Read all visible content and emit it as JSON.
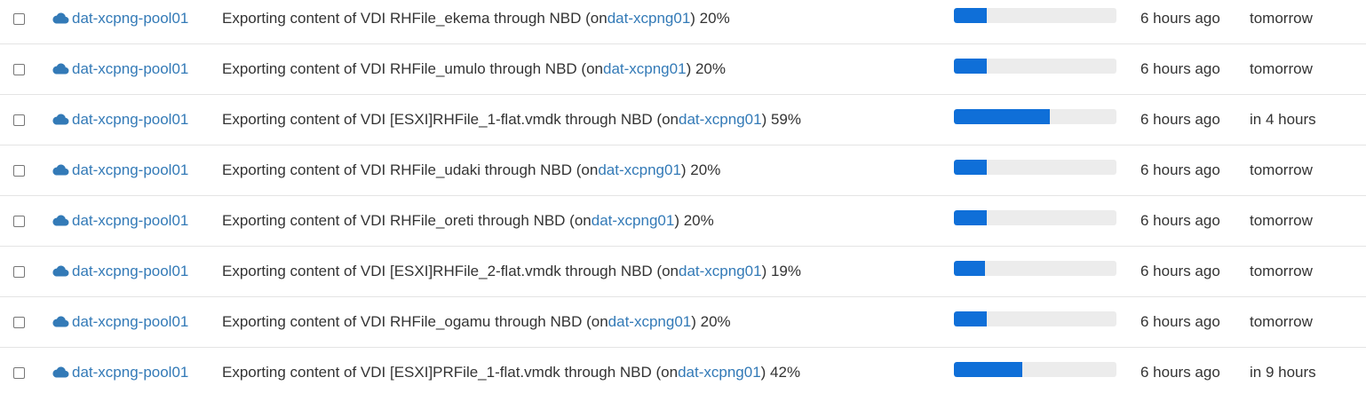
{
  "colors": {
    "link": "#337ab7",
    "progress_fill": "#0f6fd8",
    "progress_track": "#ececec",
    "row_border": "#e4e4e4"
  },
  "icons": {
    "pool": "cloud-icon"
  },
  "tasks": [
    {
      "pool": "dat-xcpng-pool01",
      "desc_prefix": "Exporting content of VDI RHFile_ekema through NBD (on ",
      "host": "dat-xcpng01",
      "desc_suffix": ") 20%",
      "progress": 20,
      "started": "6 hours ago",
      "eta": "tomorrow"
    },
    {
      "pool": "dat-xcpng-pool01",
      "desc_prefix": "Exporting content of VDI RHFile_umulo through NBD (on ",
      "host": "dat-xcpng01",
      "desc_suffix": ") 20%",
      "progress": 20,
      "started": "6 hours ago",
      "eta": "tomorrow"
    },
    {
      "pool": "dat-xcpng-pool01",
      "desc_prefix": "Exporting content of VDI [ESXI]RHFile_1-flat.vmdk through NBD (on ",
      "host": "dat-xcpng01",
      "desc_suffix": ") 59%",
      "progress": 59,
      "started": "6 hours ago",
      "eta": "in 4 hours"
    },
    {
      "pool": "dat-xcpng-pool01",
      "desc_prefix": "Exporting content of VDI RHFile_udaki through NBD (on ",
      "host": "dat-xcpng01",
      "desc_suffix": ") 20%",
      "progress": 20,
      "started": "6 hours ago",
      "eta": "tomorrow"
    },
    {
      "pool": "dat-xcpng-pool01",
      "desc_prefix": "Exporting content of VDI RHFile_oreti through NBD (on ",
      "host": "dat-xcpng01",
      "desc_suffix": ") 20%",
      "progress": 20,
      "started": "6 hours ago",
      "eta": "tomorrow"
    },
    {
      "pool": "dat-xcpng-pool01",
      "desc_prefix": "Exporting content of VDI [ESXI]RHFile_2-flat.vmdk through NBD (on ",
      "host": "dat-xcpng01",
      "desc_suffix": ") 19%",
      "progress": 19,
      "started": "6 hours ago",
      "eta": "tomorrow"
    },
    {
      "pool": "dat-xcpng-pool01",
      "desc_prefix": "Exporting content of VDI RHFile_ogamu through NBD (on ",
      "host": "dat-xcpng01",
      "desc_suffix": ") 20%",
      "progress": 20,
      "started": "6 hours ago",
      "eta": "tomorrow"
    },
    {
      "pool": "dat-xcpng-pool01",
      "desc_prefix": "Exporting content of VDI [ESXI]PRFile_1-flat.vmdk through NBD (on ",
      "host": "dat-xcpng01",
      "desc_suffix": ") 42%",
      "progress": 42,
      "started": "6 hours ago",
      "eta": "in 9 hours"
    }
  ]
}
